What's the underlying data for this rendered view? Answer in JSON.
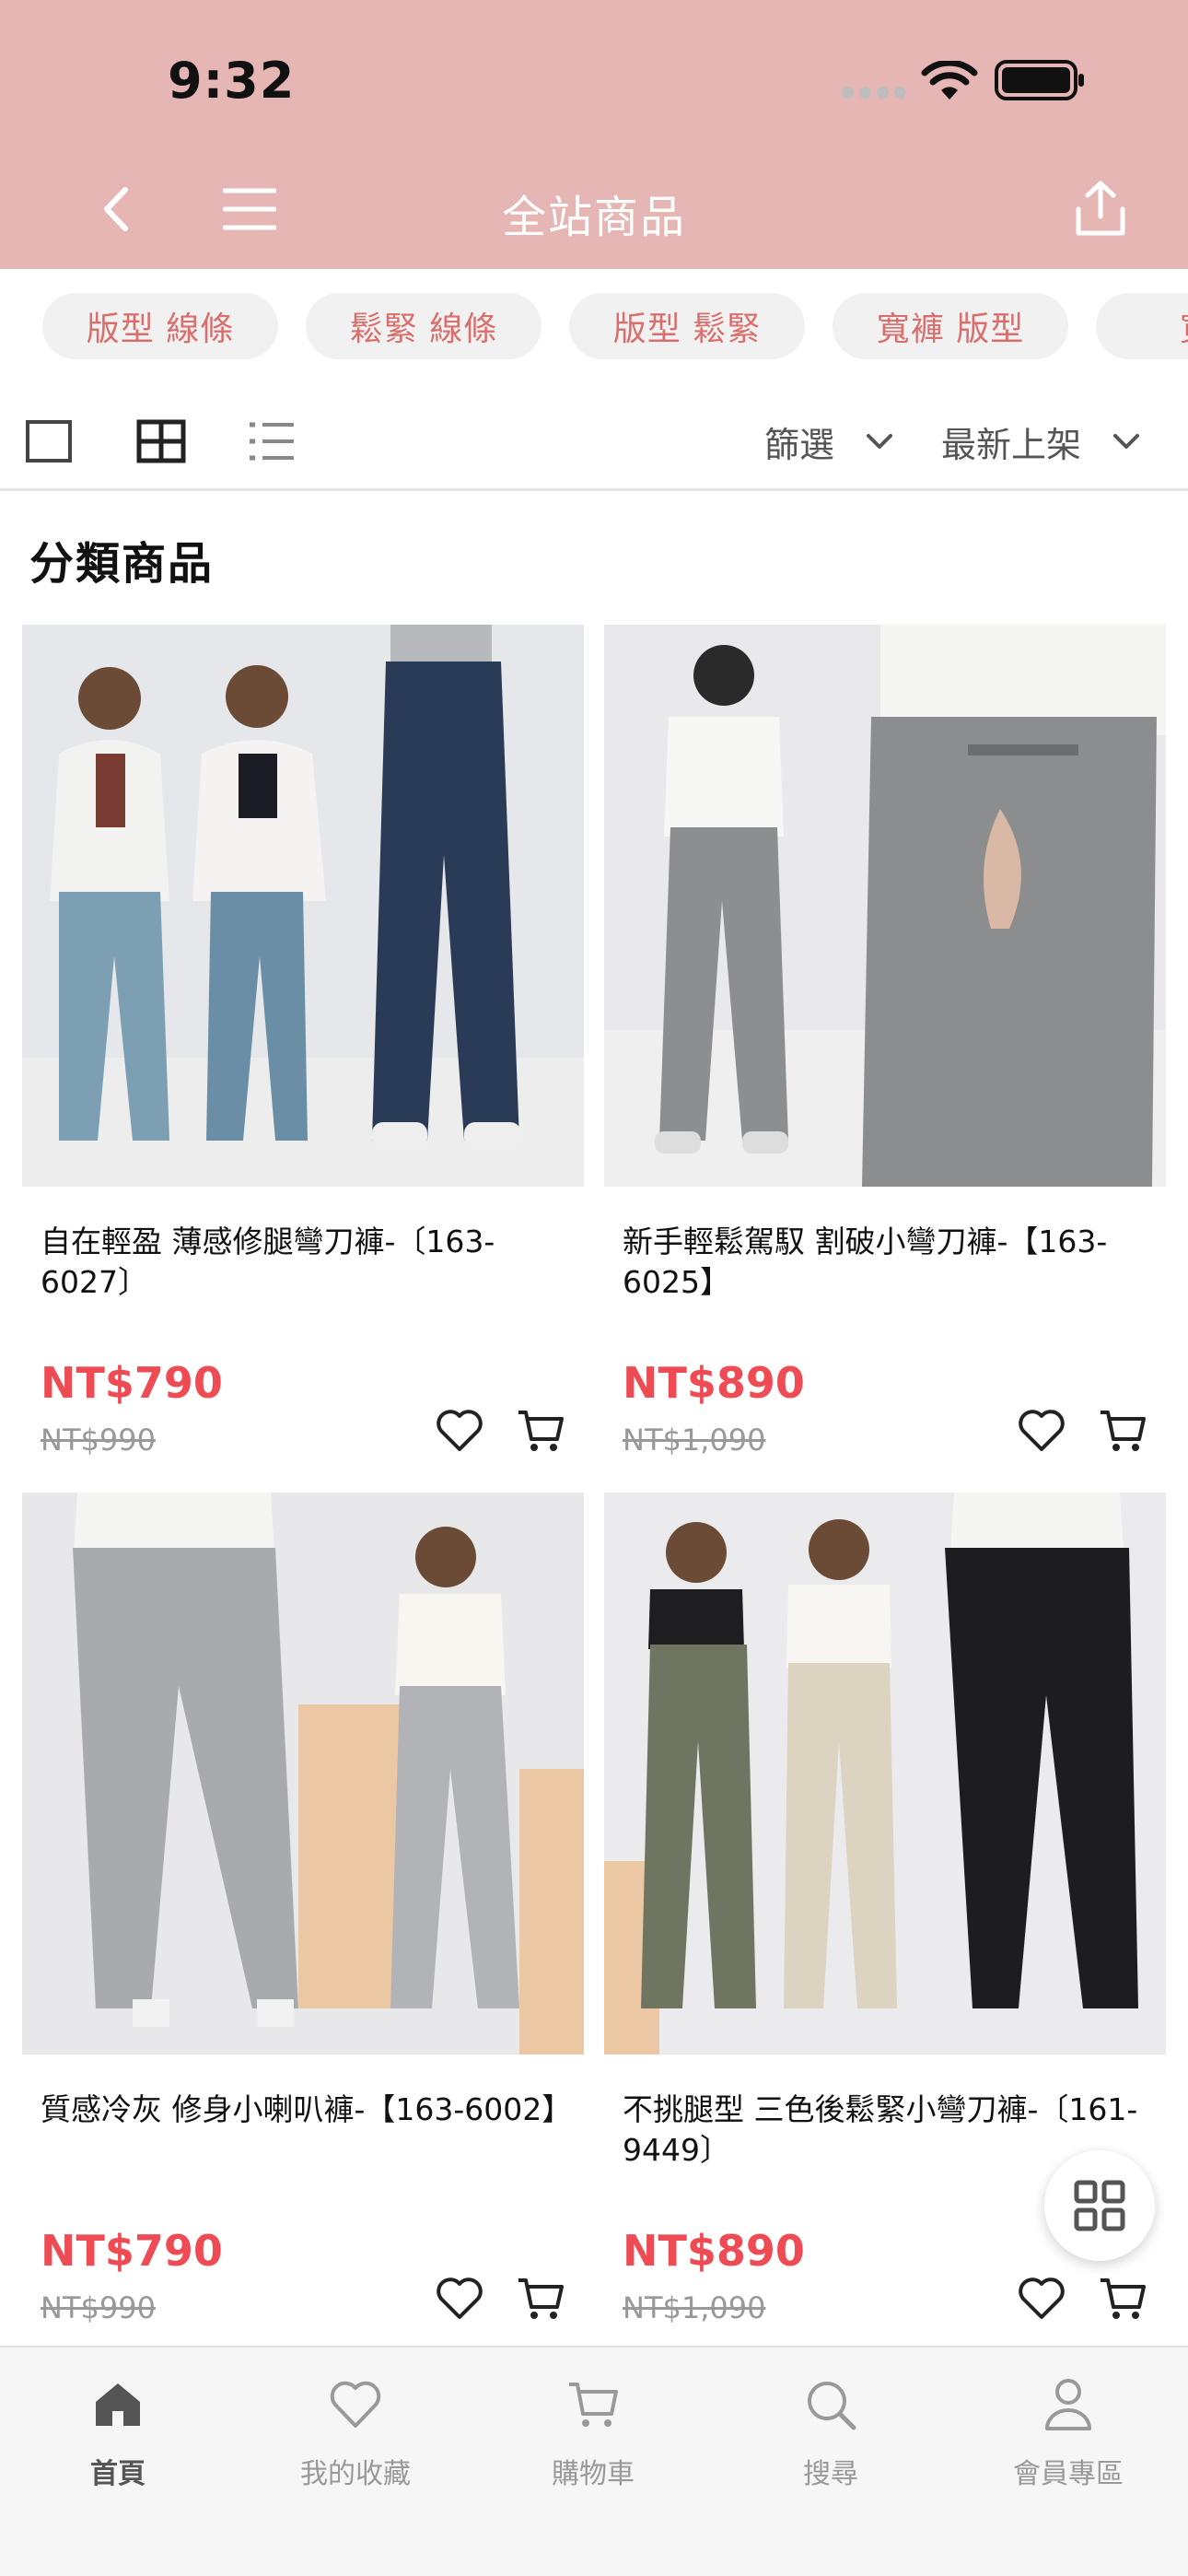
{
  "status_bar": {
    "time": "9:32"
  },
  "nav": {
    "title": "全站商品"
  },
  "tags": [
    "版型 線條",
    "鬆緊 線條",
    "版型 鬆緊",
    "寬褲 版型",
    "寬褲"
  ],
  "toolbar": {
    "filter_label": "篩選",
    "sort_label": "最新上架"
  },
  "section": {
    "title": "分類商品"
  },
  "products": [
    {
      "name": "自在輕盈 薄感修腿彎刀褲-〔163-6027〕",
      "price": "NT$790",
      "original_price": "NT$990"
    },
    {
      "name": "新手輕鬆駕馭 割破小彎刀褲-【163-6025】",
      "price": "NT$890",
      "original_price": "NT$1,090"
    },
    {
      "name": "質感冷灰 修身小喇叭褲-【163-6002】",
      "price": "NT$790",
      "original_price": "NT$990"
    },
    {
      "name": "不挑腿型 三色後鬆緊小彎刀褲-〔161-9449〕",
      "price": "NT$890",
      "original_price": "NT$1,090"
    }
  ],
  "tabbar": {
    "home": "首頁",
    "favorites": "我的收藏",
    "cart": "購物車",
    "search": "搜尋",
    "member": "會員專區"
  },
  "colors": {
    "header_bg": "#e6b6b4",
    "tag_text": "#d96f6d",
    "price": "#ee4b54"
  }
}
